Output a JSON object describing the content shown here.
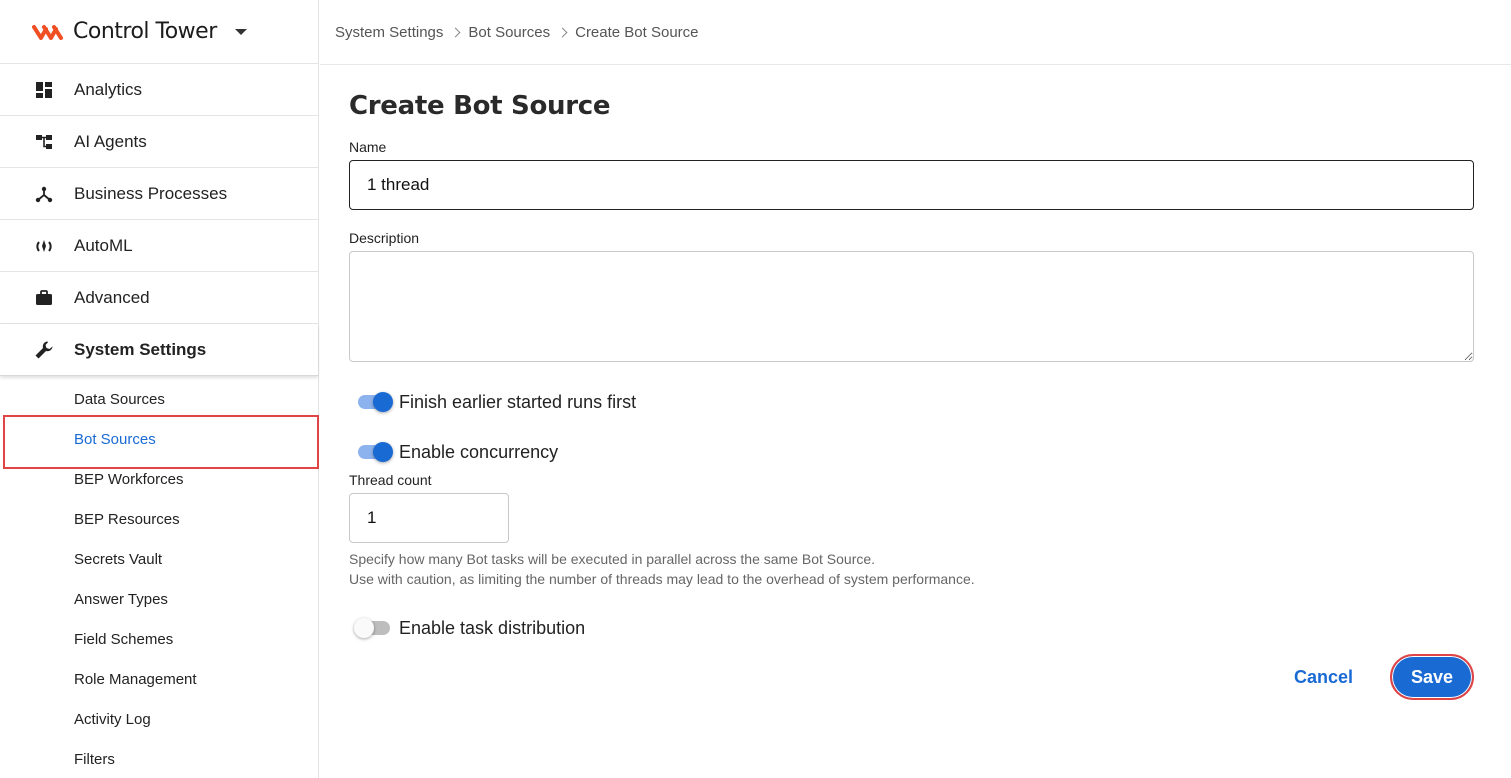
{
  "brand": {
    "name": "Control Tower",
    "logo_color": "#f04e23"
  },
  "nav": {
    "items": [
      {
        "label": "Analytics",
        "icon": "dashboard-icon"
      },
      {
        "label": "AI Agents",
        "icon": "hierarchy-icon"
      },
      {
        "label": "Business Processes",
        "icon": "process-icon"
      },
      {
        "label": "AutoML",
        "icon": "automl-icon"
      },
      {
        "label": "Advanced",
        "icon": "briefcase-icon"
      },
      {
        "label": "System Settings",
        "icon": "wrench-icon",
        "active": true
      }
    ],
    "sub_items": [
      "Data Sources",
      "Bot Sources",
      "BEP Workforces",
      "BEP Resources",
      "Secrets Vault",
      "Answer Types",
      "Field Schemes",
      "Role Management",
      "Activity Log",
      "Filters"
    ],
    "selected_sub": "Bot Sources"
  },
  "breadcrumb": [
    "System Settings",
    "Bot Sources",
    "Create Bot Source"
  ],
  "form": {
    "title": "Create Bot Source",
    "name_label": "Name",
    "name_value": "1 thread",
    "description_label": "Description",
    "description_value": "",
    "toggle_finish": {
      "label": "Finish earlier started runs first",
      "on": true
    },
    "toggle_concurrency": {
      "label": "Enable concurrency",
      "on": true
    },
    "thread_label": "Thread count",
    "thread_value": "1",
    "helper_line1": "Specify how many Bot tasks will be executed in parallel across the same Bot Source.",
    "helper_line2": "Use with caution, as limiting the number of threads may lead to the overhead of system performance.",
    "toggle_distribution": {
      "label": "Enable task distribution",
      "on": false
    }
  },
  "actions": {
    "cancel_label": "Cancel",
    "save_label": "Save"
  },
  "colors": {
    "accent": "#1a6ad4",
    "highlight": "#e04444"
  }
}
